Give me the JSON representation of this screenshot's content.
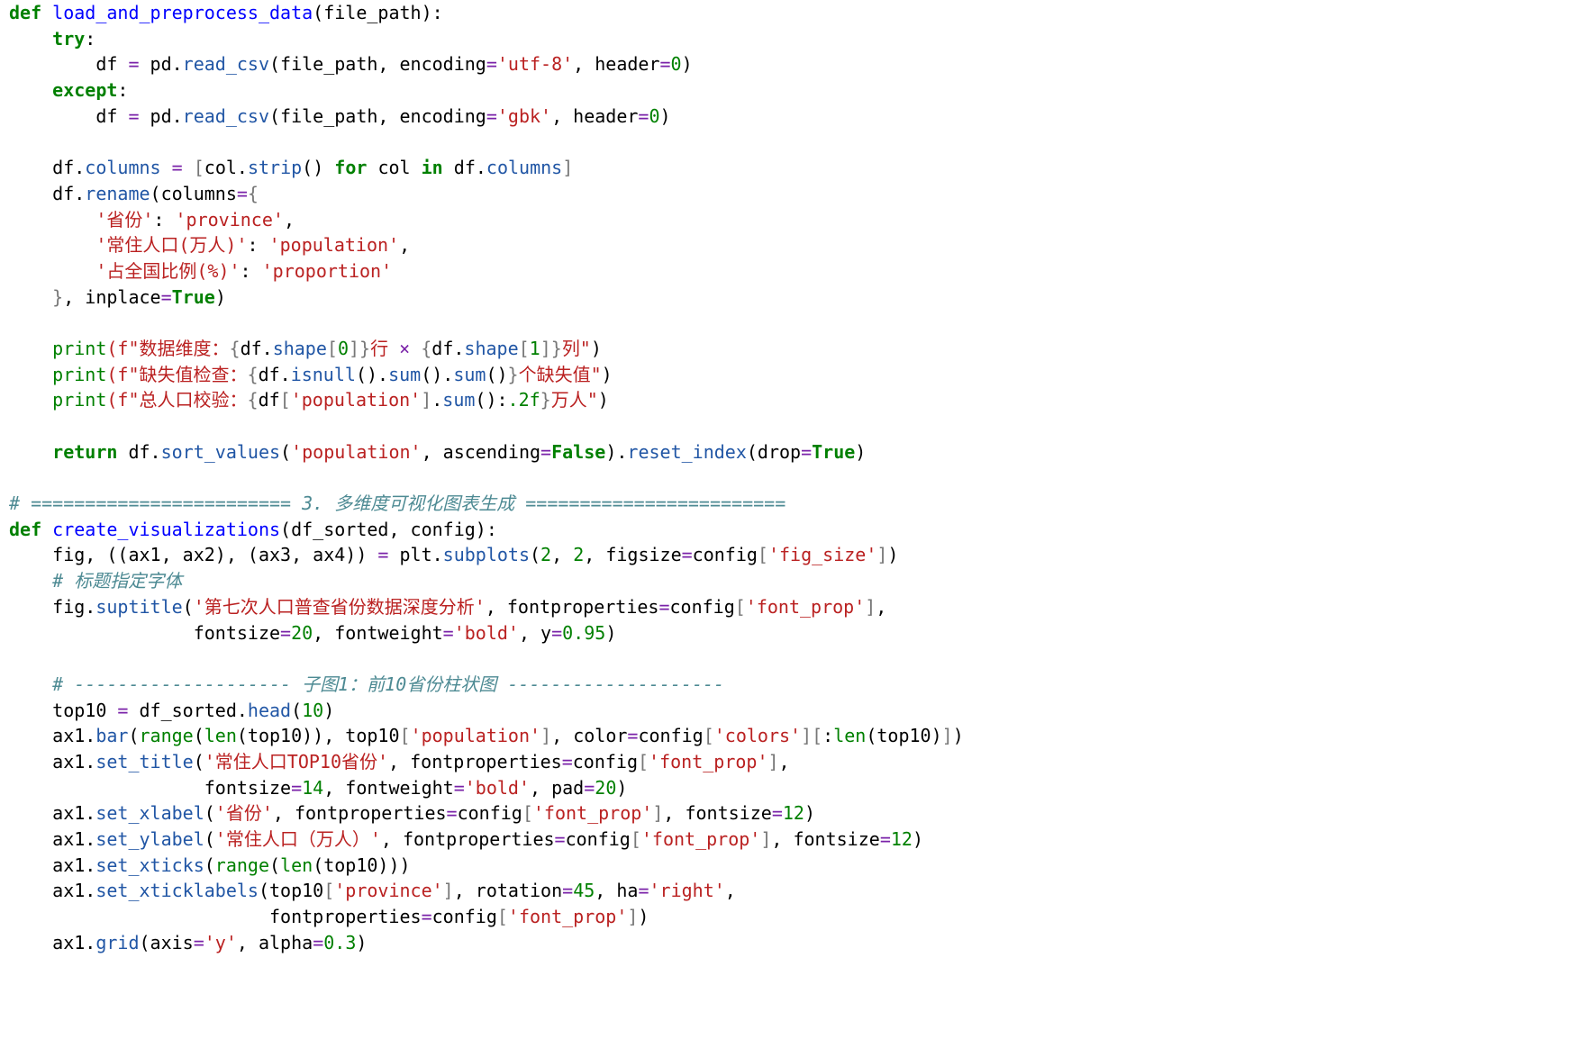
{
  "lines": [
    [
      {
        "t": "def",
        "c": "kw"
      },
      {
        "t": " "
      },
      {
        "t": "load_and_preprocess_data",
        "c": "fn"
      },
      {
        "t": "(file_path):"
      }
    ],
    [
      {
        "t": "    "
      },
      {
        "t": "try",
        "c": "kw"
      },
      {
        "t": ":"
      }
    ],
    [
      {
        "t": "        df "
      },
      {
        "t": "=",
        "c": "op"
      },
      {
        "t": " pd."
      },
      {
        "t": "read_csv",
        "c": "at"
      },
      {
        "t": "(file_path, encoding"
      },
      {
        "t": "=",
        "c": "op"
      },
      {
        "t": "'utf-8'",
        "c": "st"
      },
      {
        "t": ", header"
      },
      {
        "t": "=",
        "c": "op"
      },
      {
        "t": "0",
        "c": "nu"
      },
      {
        "t": ")"
      }
    ],
    [
      {
        "t": "    "
      },
      {
        "t": "except",
        "c": "kw"
      },
      {
        "t": ":"
      }
    ],
    [
      {
        "t": "        df "
      },
      {
        "t": "=",
        "c": "op"
      },
      {
        "t": " pd."
      },
      {
        "t": "read_csv",
        "c": "at"
      },
      {
        "t": "(file_path, encoding"
      },
      {
        "t": "=",
        "c": "op"
      },
      {
        "t": "'gbk'",
        "c": "st"
      },
      {
        "t": ", header"
      },
      {
        "t": "=",
        "c": "op"
      },
      {
        "t": "0",
        "c": "nu"
      },
      {
        "t": ")"
      }
    ],
    [],
    [
      {
        "t": "    df."
      },
      {
        "t": "columns",
        "c": "at"
      },
      {
        "t": " "
      },
      {
        "t": "=",
        "c": "op"
      },
      {
        "t": " "
      },
      {
        "t": "[",
        "c": "br"
      },
      {
        "t": "col."
      },
      {
        "t": "strip",
        "c": "at"
      },
      {
        "t": "() "
      },
      {
        "t": "for",
        "c": "kw"
      },
      {
        "t": " col "
      },
      {
        "t": "in",
        "c": "kw"
      },
      {
        "t": " df."
      },
      {
        "t": "columns",
        "c": "at"
      },
      {
        "t": "]",
        "c": "br"
      }
    ],
    [
      {
        "t": "    df."
      },
      {
        "t": "rename",
        "c": "at"
      },
      {
        "t": "(columns"
      },
      {
        "t": "=",
        "c": "op"
      },
      {
        "t": "{",
        "c": "br"
      }
    ],
    [
      {
        "t": "        "
      },
      {
        "t": "'省份'",
        "c": "st"
      },
      {
        "t": ": "
      },
      {
        "t": "'province'",
        "c": "st"
      },
      {
        "t": ","
      }
    ],
    [
      {
        "t": "        "
      },
      {
        "t": "'常住人口(万人)'",
        "c": "st"
      },
      {
        "t": ": "
      },
      {
        "t": "'population'",
        "c": "st"
      },
      {
        "t": ","
      }
    ],
    [
      {
        "t": "        "
      },
      {
        "t": "'占全国比例(%)'",
        "c": "st"
      },
      {
        "t": ": "
      },
      {
        "t": "'proportion'",
        "c": "st"
      }
    ],
    [
      {
        "t": "    "
      },
      {
        "t": "}",
        "c": "br"
      },
      {
        "t": ", inplace"
      },
      {
        "t": "=",
        "c": "op"
      },
      {
        "t": "True",
        "c": "kw"
      },
      {
        "t": ")"
      }
    ],
    [],
    [
      {
        "t": "    "
      },
      {
        "t": "print",
        "c": "nu"
      },
      {
        "t": "(f\"数据维度：",
        "c": "st"
      },
      {
        "t": "{",
        "c": "br"
      },
      {
        "t": "df."
      },
      {
        "t": "shape",
        "c": "at"
      },
      {
        "t": "[",
        "c": "br"
      },
      {
        "t": "0",
        "c": "nu"
      },
      {
        "t": "]}",
        "c": "br"
      },
      {
        "t": "行 ",
        "c": "st"
      },
      {
        "t": "×",
        "c": "op"
      },
      {
        "t": " ",
        "c": "st"
      },
      {
        "t": "{",
        "c": "br"
      },
      {
        "t": "df."
      },
      {
        "t": "shape",
        "c": "at"
      },
      {
        "t": "[",
        "c": "br"
      },
      {
        "t": "1",
        "c": "nu"
      },
      {
        "t": "]}",
        "c": "br"
      },
      {
        "t": "列\"",
        "c": "st"
      },
      {
        "t": ")"
      }
    ],
    [
      {
        "t": "    "
      },
      {
        "t": "print",
        "c": "nu"
      },
      {
        "t": "(f\"缺失值检查：",
        "c": "st"
      },
      {
        "t": "{",
        "c": "br"
      },
      {
        "t": "df."
      },
      {
        "t": "isnull",
        "c": "at"
      },
      {
        "t": "()."
      },
      {
        "t": "sum",
        "c": "at"
      },
      {
        "t": "()."
      },
      {
        "t": "sum",
        "c": "at"
      },
      {
        "t": "()"
      },
      {
        "t": "}",
        "c": "br"
      },
      {
        "t": "个缺失值\"",
        "c": "st"
      },
      {
        "t": ")"
      }
    ],
    [
      {
        "t": "    "
      },
      {
        "t": "print",
        "c": "nu"
      },
      {
        "t": "(f\"总人口校验：",
        "c": "st"
      },
      {
        "t": "{",
        "c": "br"
      },
      {
        "t": "df"
      },
      {
        "t": "[",
        "c": "br"
      },
      {
        "t": "'population'",
        "c": "st"
      },
      {
        "t": "]",
        "c": "br"
      },
      {
        "t": "."
      },
      {
        "t": "sum",
        "c": "at"
      },
      {
        "t": "():"
      },
      {
        "t": ".2f",
        "c": "nu"
      },
      {
        "t": "}",
        "c": "br"
      },
      {
        "t": "万人\"",
        "c": "st"
      },
      {
        "t": ")"
      }
    ],
    [],
    [
      {
        "t": "    "
      },
      {
        "t": "return",
        "c": "kw"
      },
      {
        "t": " df."
      },
      {
        "t": "sort_values",
        "c": "at"
      },
      {
        "t": "("
      },
      {
        "t": "'population'",
        "c": "st"
      },
      {
        "t": ", ascending"
      },
      {
        "t": "=",
        "c": "op"
      },
      {
        "t": "False",
        "c": "kw"
      },
      {
        "t": ")."
      },
      {
        "t": "reset_index",
        "c": "at"
      },
      {
        "t": "(drop"
      },
      {
        "t": "=",
        "c": "op"
      },
      {
        "t": "True",
        "c": "kw"
      },
      {
        "t": ")"
      }
    ],
    [],
    [
      {
        "t": "# ======================== 3. 多维度可视化图表生成 ========================",
        "c": "cm"
      }
    ],
    [
      {
        "t": "def",
        "c": "kw"
      },
      {
        "t": " "
      },
      {
        "t": "create_visualizations",
        "c": "fn"
      },
      {
        "t": "(df_sorted, config):"
      }
    ],
    [
      {
        "t": "    fig, ((ax1, ax2), (ax3, ax4)) "
      },
      {
        "t": "=",
        "c": "op"
      },
      {
        "t": " plt."
      },
      {
        "t": "subplots",
        "c": "at"
      },
      {
        "t": "("
      },
      {
        "t": "2",
        "c": "nu"
      },
      {
        "t": ", "
      },
      {
        "t": "2",
        "c": "nu"
      },
      {
        "t": ", figsize"
      },
      {
        "t": "=",
        "c": "op"
      },
      {
        "t": "config"
      },
      {
        "t": "[",
        "c": "br"
      },
      {
        "t": "'fig_size'",
        "c": "st"
      },
      {
        "t": "]",
        "c": "br"
      },
      {
        "t": ")"
      }
    ],
    [
      {
        "t": "    # 标题指定字体",
        "c": "cm"
      }
    ],
    [
      {
        "t": "    fig."
      },
      {
        "t": "suptitle",
        "c": "at"
      },
      {
        "t": "("
      },
      {
        "t": "'第七次人口普查省份数据深度分析'",
        "c": "st"
      },
      {
        "t": ", fontproperties"
      },
      {
        "t": "=",
        "c": "op"
      },
      {
        "t": "config"
      },
      {
        "t": "[",
        "c": "br"
      },
      {
        "t": "'font_prop'",
        "c": "st"
      },
      {
        "t": "]",
        "c": "br"
      },
      {
        "t": ","
      }
    ],
    [
      {
        "t": "                 fontsize"
      },
      {
        "t": "=",
        "c": "op"
      },
      {
        "t": "20",
        "c": "nu"
      },
      {
        "t": ", fontweight"
      },
      {
        "t": "=",
        "c": "op"
      },
      {
        "t": "'bold'",
        "c": "st"
      },
      {
        "t": ", y"
      },
      {
        "t": "=",
        "c": "op"
      },
      {
        "t": "0.95",
        "c": "nu"
      },
      {
        "t": ")"
      }
    ],
    [],
    [
      {
        "t": "    # -------------------- 子图1：前10省份柱状图 --------------------",
        "c": "cm"
      }
    ],
    [
      {
        "t": "    top10 "
      },
      {
        "t": "=",
        "c": "op"
      },
      {
        "t": " df_sorted."
      },
      {
        "t": "head",
        "c": "at"
      },
      {
        "t": "("
      },
      {
        "t": "10",
        "c": "nu"
      },
      {
        "t": ")"
      }
    ],
    [
      {
        "t": "    ax1."
      },
      {
        "t": "bar",
        "c": "at"
      },
      {
        "t": "("
      },
      {
        "t": "range",
        "c": "nu"
      },
      {
        "t": "("
      },
      {
        "t": "len",
        "c": "nu"
      },
      {
        "t": "(top10)), top10"
      },
      {
        "t": "[",
        "c": "br"
      },
      {
        "t": "'population'",
        "c": "st"
      },
      {
        "t": "]",
        "c": "br"
      },
      {
        "t": ", color"
      },
      {
        "t": "=",
        "c": "op"
      },
      {
        "t": "config"
      },
      {
        "t": "[",
        "c": "br"
      },
      {
        "t": "'colors'",
        "c": "st"
      },
      {
        "t": "][",
        "c": "br"
      },
      {
        "t": ":"
      },
      {
        "t": "len",
        "c": "nu"
      },
      {
        "t": "(top10)"
      },
      {
        "t": "]",
        "c": "br"
      },
      {
        "t": ")"
      }
    ],
    [
      {
        "t": "    ax1."
      },
      {
        "t": "set_title",
        "c": "at"
      },
      {
        "t": "("
      },
      {
        "t": "'常住人口TOP10省份'",
        "c": "st"
      },
      {
        "t": ", fontproperties"
      },
      {
        "t": "=",
        "c": "op"
      },
      {
        "t": "config"
      },
      {
        "t": "[",
        "c": "br"
      },
      {
        "t": "'font_prop'",
        "c": "st"
      },
      {
        "t": "]",
        "c": "br"
      },
      {
        "t": ","
      }
    ],
    [
      {
        "t": "                  fontsize"
      },
      {
        "t": "=",
        "c": "op"
      },
      {
        "t": "14",
        "c": "nu"
      },
      {
        "t": ", fontweight"
      },
      {
        "t": "=",
        "c": "op"
      },
      {
        "t": "'bold'",
        "c": "st"
      },
      {
        "t": ", pad"
      },
      {
        "t": "=",
        "c": "op"
      },
      {
        "t": "20",
        "c": "nu"
      },
      {
        "t": ")"
      }
    ],
    [
      {
        "t": "    ax1."
      },
      {
        "t": "set_xlabel",
        "c": "at"
      },
      {
        "t": "("
      },
      {
        "t": "'省份'",
        "c": "st"
      },
      {
        "t": ", fontproperties"
      },
      {
        "t": "=",
        "c": "op"
      },
      {
        "t": "config"
      },
      {
        "t": "[",
        "c": "br"
      },
      {
        "t": "'font_prop'",
        "c": "st"
      },
      {
        "t": "]",
        "c": "br"
      },
      {
        "t": ", fontsize"
      },
      {
        "t": "=",
        "c": "op"
      },
      {
        "t": "12",
        "c": "nu"
      },
      {
        "t": ")"
      }
    ],
    [
      {
        "t": "    ax1."
      },
      {
        "t": "set_ylabel",
        "c": "at"
      },
      {
        "t": "("
      },
      {
        "t": "'常住人口（万人）'",
        "c": "st"
      },
      {
        "t": ", fontproperties"
      },
      {
        "t": "=",
        "c": "op"
      },
      {
        "t": "config"
      },
      {
        "t": "[",
        "c": "br"
      },
      {
        "t": "'font_prop'",
        "c": "st"
      },
      {
        "t": "]",
        "c": "br"
      },
      {
        "t": ", fontsize"
      },
      {
        "t": "=",
        "c": "op"
      },
      {
        "t": "12",
        "c": "nu"
      },
      {
        "t": ")"
      }
    ],
    [
      {
        "t": "    ax1."
      },
      {
        "t": "set_xticks",
        "c": "at"
      },
      {
        "t": "("
      },
      {
        "t": "range",
        "c": "nu"
      },
      {
        "t": "("
      },
      {
        "t": "len",
        "c": "nu"
      },
      {
        "t": "(top10)))"
      }
    ],
    [
      {
        "t": "    ax1."
      },
      {
        "t": "set_xticklabels",
        "c": "at"
      },
      {
        "t": "(top10"
      },
      {
        "t": "[",
        "c": "br"
      },
      {
        "t": "'province'",
        "c": "st"
      },
      {
        "t": "]",
        "c": "br"
      },
      {
        "t": ", rotation"
      },
      {
        "t": "=",
        "c": "op"
      },
      {
        "t": "45",
        "c": "nu"
      },
      {
        "t": ", ha"
      },
      {
        "t": "=",
        "c": "op"
      },
      {
        "t": "'right'",
        "c": "st"
      },
      {
        "t": ","
      }
    ],
    [
      {
        "t": "                        fontproperties"
      },
      {
        "t": "=",
        "c": "op"
      },
      {
        "t": "config"
      },
      {
        "t": "[",
        "c": "br"
      },
      {
        "t": "'font_prop'",
        "c": "st"
      },
      {
        "t": "]",
        "c": "br"
      },
      {
        "t": ")"
      }
    ],
    [
      {
        "t": "    ax1."
      },
      {
        "t": "grid",
        "c": "at"
      },
      {
        "t": "(axis"
      },
      {
        "t": "=",
        "c": "op"
      },
      {
        "t": "'y'",
        "c": "st"
      },
      {
        "t": ", alpha"
      },
      {
        "t": "=",
        "c": "op"
      },
      {
        "t": "0.3",
        "c": "nu"
      },
      {
        "t": ")"
      }
    ]
  ]
}
